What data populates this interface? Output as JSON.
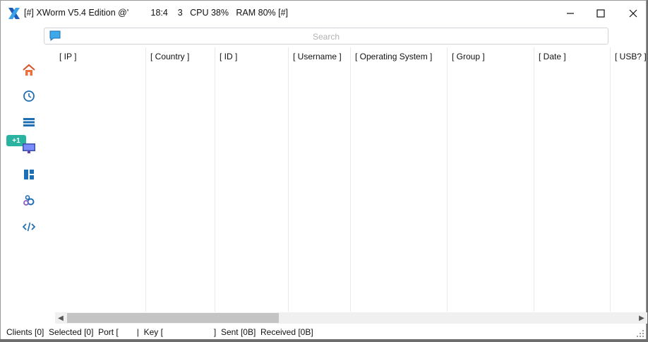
{
  "window": {
    "title": "[#] XWorm V5.4 Edition @'         18:4    3   CPU 38%   RAM 80% [#]"
  },
  "search": {
    "placeholder": "Search"
  },
  "sidebar": {
    "badge": "+1",
    "items": [
      {
        "icon": "home-icon"
      },
      {
        "icon": "history-icon"
      },
      {
        "icon": "list-icon"
      },
      {
        "icon": "monitor-icon"
      },
      {
        "icon": "dashboard-icon"
      },
      {
        "icon": "settings-gears-icon"
      },
      {
        "icon": "code-icon"
      }
    ]
  },
  "table": {
    "columns": [
      "[ IP ]",
      "[ Country ]",
      "[ ID ]",
      "[ Username ]",
      "[ Operating System ]",
      "[ Group ]",
      "[ Date ]",
      "[ USB? ]"
    ]
  },
  "status": {
    "clients": "Clients [0]",
    "selected": "Selected [0]",
    "port": "Port [",
    "sep": "|",
    "key": "Key [",
    "key_end": "]",
    "sent": "Sent [0B]",
    "received": "Received [0B]"
  },
  "colors": {
    "accent": "#2bb3a1",
    "icon_blue": "#1f6fb5"
  }
}
